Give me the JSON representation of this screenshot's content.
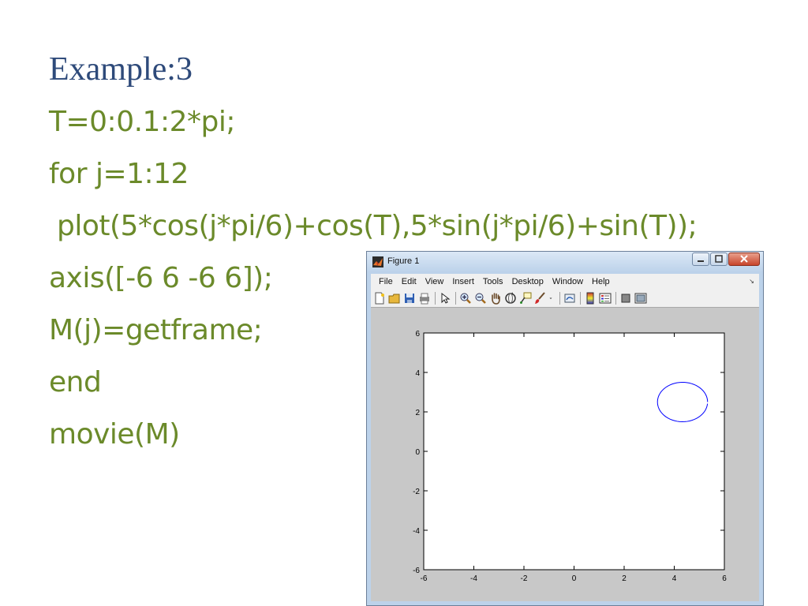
{
  "slide": {
    "title": "Example:3",
    "code_lines": [
      "T=0:0.1:2*pi;",
      "for j=1:12",
      "plot(5*cos(j*pi/6)+cos(T),5*sin(j*pi/6)+sin(T));",
      "axis([-6 6 -6 6]);",
      "M(j)=getframe;",
      "end",
      "movie(M)"
    ]
  },
  "figure_window": {
    "title": "Figure 1",
    "menu": [
      "File",
      "Edit",
      "View",
      "Insert",
      "Tools",
      "Desktop",
      "Window",
      "Help"
    ],
    "toolbar_icons": [
      "new-figure-icon",
      "open-file-icon",
      "save-icon",
      "print-icon",
      "select-arrow-icon",
      "zoom-in-icon",
      "zoom-out-icon",
      "pan-hand-icon",
      "rotate-3d-icon",
      "data-cursor-icon",
      "brush-icon",
      "brush-dropdown-icon",
      "link-plot-icon",
      "colorbar-icon",
      "legend-icon",
      "hide-plot-tools-icon",
      "show-plot-tools-icon"
    ],
    "colors": {
      "line": "#0000ff",
      "canvas": "#c8c8c8",
      "axes_bg": "#ffffff",
      "code_text": "#6b8a2a",
      "title_text": "#2e4a7a"
    }
  },
  "chart_data": {
    "type": "line",
    "xlim": [
      -6,
      6
    ],
    "ylim": [
      -6,
      6
    ],
    "x_ticks": [
      -6,
      -4,
      -2,
      0,
      2,
      4,
      6
    ],
    "y_ticks": [
      -6,
      -4,
      -2,
      0,
      2,
      4,
      6
    ],
    "grid": false,
    "series": [
      {
        "shape": "circle",
        "center": [
          4.33,
          2.5
        ],
        "radius": 1,
        "t_step": 0.1
      }
    ]
  }
}
